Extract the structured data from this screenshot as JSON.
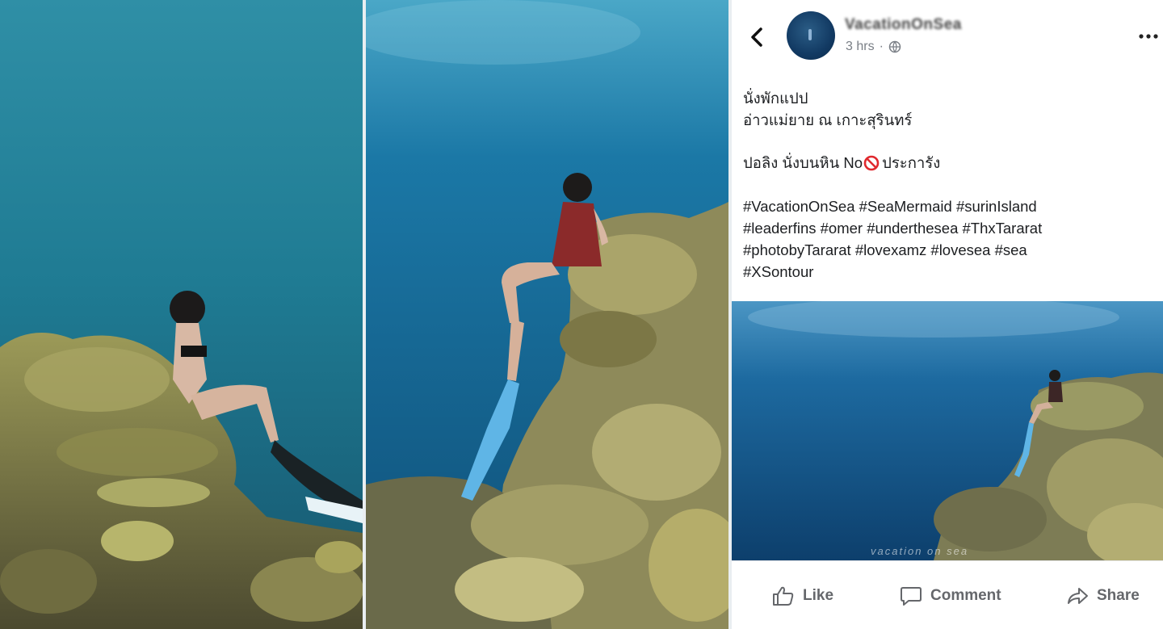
{
  "post": {
    "page_name": "VacationOnSea",
    "time": "3 hrs",
    "meta_separator": "·",
    "lines": {
      "line1": "นั่งพักแปป",
      "line2": "อ่าวแม่ยาย ณ เกาะสุรินทร์",
      "line3_before": "ปอลิง นั่งบนหิน No",
      "line3_after": "ประการัง",
      "tags1": "#VacationOnSea #SeaMermaid #surinIsland",
      "tags2": "#leaderfins #omer #underthesea #ThxTararat",
      "tags3": "#photobyTararat #lovexamz #lovesea #sea",
      "tags4": "#XSontour"
    },
    "image_watermark": "vacation on sea"
  },
  "actions": {
    "like": "Like",
    "comment": "Comment",
    "share": "Share"
  },
  "icons": {
    "back": "chevron-left-icon",
    "globe": "globe-icon",
    "more": "more-dots-icon",
    "no": "prohibited-icon",
    "like": "thumbs-up-icon",
    "comment": "comment-bubble-icon",
    "share": "share-arrow-icon"
  }
}
